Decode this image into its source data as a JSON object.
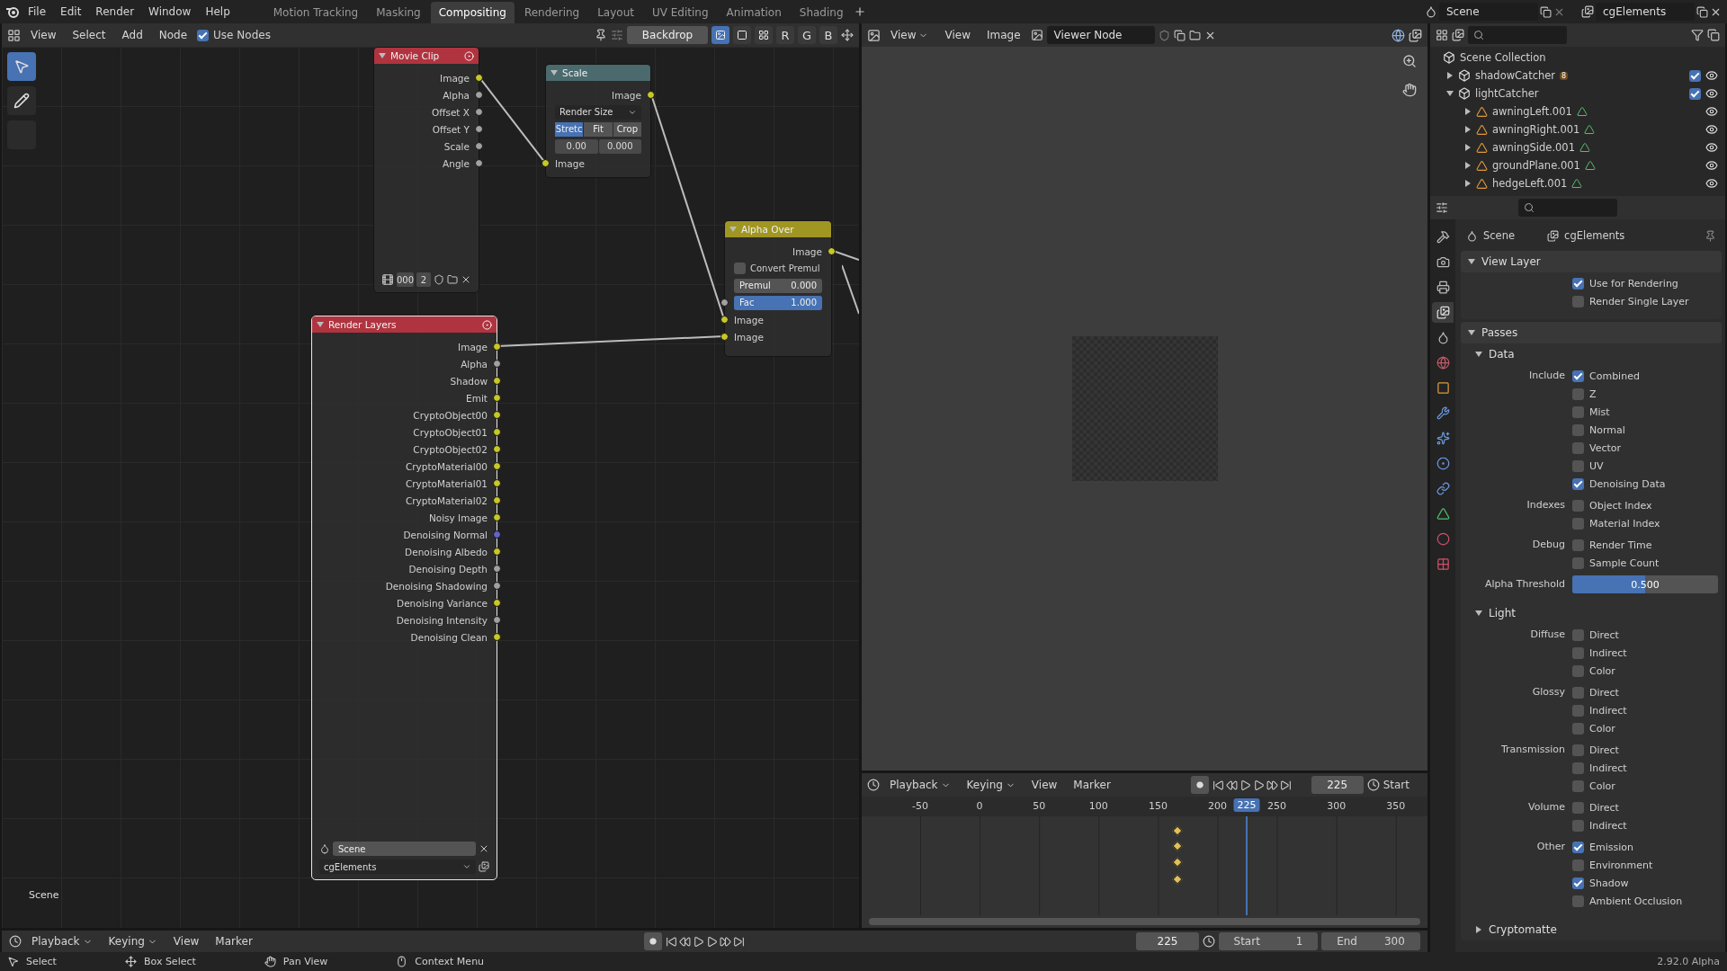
{
  "topbar": {
    "menus": [
      "File",
      "Edit",
      "Render",
      "Window",
      "Help"
    ],
    "workspaces": [
      {
        "label": "Motion Tracking",
        "selected": false
      },
      {
        "label": "Masking",
        "selected": false
      },
      {
        "label": "Compositing",
        "selected": true
      },
      {
        "label": "Rendering",
        "selected": false
      },
      {
        "label": "Layout",
        "selected": false
      },
      {
        "label": "UV Editing",
        "selected": false
      },
      {
        "label": "Animation",
        "selected": false
      },
      {
        "label": "Shading",
        "selected": false
      }
    ],
    "scene": "Scene",
    "view_layer": "cgElements"
  },
  "node_editor": {
    "menus": [
      "View",
      "Select",
      "Add",
      "Node"
    ],
    "use_nodes": {
      "label": "Use Nodes",
      "checked": true
    },
    "backdrop": "Backdrop",
    "channel_buttons": [
      {
        "kind": "color_alpha",
        "selected": true
      },
      {
        "kind": "color",
        "selected": false
      },
      {
        "kind": "alpha",
        "selected": false
      }
    ],
    "channels": [
      "R",
      "G",
      "B"
    ],
    "tools": [
      {
        "kind": "select",
        "selected": true
      },
      {
        "kind": "annotate",
        "selected": false
      },
      {
        "kind": "measure",
        "selected": false
      }
    ],
    "nodes": [
      {
        "title": "Movie Clip",
        "kind": "input",
        "selected": false,
        "rows": [
          {
            "kind": "output",
            "label": "Image",
            "color": "#c7c729"
          },
          {
            "kind": "output",
            "label": "Alpha",
            "color": "#a1a1a1"
          },
          {
            "kind": "output",
            "label": "Offset X",
            "color": "#a1a1a1"
          },
          {
            "kind": "output",
            "label": "Offset Y",
            "color": "#a1a1a1"
          },
          {
            "kind": "output",
            "label": "Scale",
            "color": "#a1a1a1"
          },
          {
            "kind": "output",
            "label": "Angle",
            "color": "#a1a1a1"
          }
        ],
        "footer": {
          "kind": "clip",
          "frame": "000",
          "users": "2"
        }
      },
      {
        "title": "Scale",
        "kind": "distort",
        "selected": false,
        "rows": [
          {
            "kind": "output",
            "label": "Image",
            "color": "#c7c729"
          },
          {
            "kind": "dropdown",
            "label": "Render Size"
          },
          {
            "kind": "segmented",
            "options": [
              {
                "label": "Stretc",
                "selected": true
              },
              {
                "label": "Fit",
                "selected": false
              },
              {
                "label": "Crop",
                "selected": false
              }
            ]
          },
          {
            "kind": "numbers",
            "values": [
              "0.00",
              "0.000"
            ]
          },
          {
            "kind": "input",
            "label": "Image",
            "color": "#c7c729"
          }
        ]
      },
      {
        "title": "Alpha Over",
        "kind": "color",
        "selected": false,
        "rows": [
          {
            "kind": "output",
            "label": "Image",
            "color": "#c7c729"
          },
          {
            "kind": "checkbox",
            "label": "Convert Premul",
            "checked": false
          },
          {
            "kind": "field",
            "label": "Premul",
            "value": "0.000"
          },
          {
            "kind": "slider",
            "label": "Fac",
            "value": "1.000",
            "level": 1,
            "color": "#a1a1a1"
          },
          {
            "kind": "input",
            "label": "Image",
            "color": "#c7c729"
          },
          {
            "kind": "input",
            "label": "Image",
            "color": "#c7c729"
          }
        ]
      },
      {
        "title": "Render Layers",
        "kind": "input",
        "selected": true,
        "rows": [
          {
            "kind": "output",
            "label": "Image",
            "color": "#c7c729"
          },
          {
            "kind": "output",
            "label": "Alpha",
            "color": "#a1a1a1"
          },
          {
            "kind": "output",
            "label": "Shadow",
            "color": "#c7c729"
          },
          {
            "kind": "output",
            "label": "Emit",
            "color": "#c7c729"
          },
          {
            "kind": "output",
            "label": "CryptoObject00",
            "color": "#c7c729"
          },
          {
            "kind": "output",
            "label": "CryptoObject01",
            "color": "#c7c729"
          },
          {
            "kind": "output",
            "label": "CryptoObject02",
            "color": "#c7c729"
          },
          {
            "kind": "output",
            "label": "CryptoMaterial00",
            "color": "#c7c729"
          },
          {
            "kind": "output",
            "label": "CryptoMaterial01",
            "color": "#c7c729"
          },
          {
            "kind": "output",
            "label": "CryptoMaterial02",
            "color": "#c7c729"
          },
          {
            "kind": "output",
            "label": "Noisy Image",
            "color": "#c7c729"
          },
          {
            "kind": "output",
            "label": "Denoising Normal",
            "color": "#6363c7"
          },
          {
            "kind": "output",
            "label": "Denoising Albedo",
            "color": "#c7c729"
          },
          {
            "kind": "output",
            "label": "Denoising Depth",
            "color": "#a1a1a1"
          },
          {
            "kind": "output",
            "label": "Denoising Shadowing",
            "color": "#a1a1a1"
          },
          {
            "kind": "output",
            "label": "Denoising Variance",
            "color": "#c7c729"
          },
          {
            "kind": "output",
            "label": "Denoising Intensity",
            "color": "#a1a1a1"
          },
          {
            "kind": "output",
            "label": "Denoising Clean",
            "color": "#c7c729"
          }
        ],
        "footer": {
          "kind": "scene",
          "scene": "Scene",
          "layer": "cgElements"
        }
      }
    ],
    "scene_label": "Scene"
  },
  "image_editor": {
    "view_menu": "View",
    "menus": [
      "View",
      "Image"
    ],
    "image": "Viewer Node"
  },
  "timeline": {
    "menus": [
      {
        "label": "Playback",
        "dropdown": true
      },
      {
        "label": "Keying",
        "dropdown": true
      },
      {
        "label": "View",
        "dropdown": false
      },
      {
        "label": "Marker",
        "dropdown": false
      }
    ],
    "frame": "225",
    "start_label": "Start",
    "ruler": [
      "-50",
      "0",
      "50",
      "100",
      "150",
      "200",
      "250",
      "300",
      "350"
    ],
    "current": "225"
  },
  "bottom_timeline": {
    "menus": [
      {
        "label": "Playback",
        "dropdown": true
      },
      {
        "label": "Keying",
        "dropdown": true
      },
      {
        "label": "View",
        "dropdown": false
      },
      {
        "label": "Marker",
        "dropdown": false
      }
    ],
    "frame": "225",
    "start_label": "Start",
    "start": "1",
    "end_label": "End",
    "end": "300"
  },
  "outliner": {
    "root": "Scene Collection",
    "items": [
      {
        "name": "shadowCatcher",
        "kind": "collection",
        "expanded": false,
        "checked": true,
        "visible": true,
        "badge": "8"
      },
      {
        "name": "lightCatcher",
        "kind": "collection",
        "expanded": true,
        "checked": true,
        "visible": true,
        "children": [
          {
            "name": "awningLeft.001",
            "kind": "mesh",
            "expanded": false,
            "visible": true
          },
          {
            "name": "awningRight.001",
            "kind": "mesh",
            "expanded": false,
            "visible": true
          },
          {
            "name": "awningSide.001",
            "kind": "mesh",
            "expanded": false,
            "visible": true
          },
          {
            "name": "groundPlane.001",
            "kind": "mesh",
            "expanded": false,
            "visible": true
          },
          {
            "name": "hedgeLeft.001",
            "kind": "mesh",
            "expanded": false,
            "visible": true
          }
        ]
      }
    ]
  },
  "properties": {
    "tabs": [
      {
        "kind": "tool",
        "selected": false
      },
      {
        "kind": "render",
        "selected": false
      },
      {
        "kind": "output",
        "selected": false
      },
      {
        "kind": "view_layer",
        "selected": true
      },
      {
        "kind": "scene",
        "selected": false
      },
      {
        "kind": "world",
        "selected": false
      },
      {
        "kind": "object",
        "selected": false
      },
      {
        "kind": "modifiers",
        "selected": false
      },
      {
        "kind": "particles",
        "selected": false
      },
      {
        "kind": "physics",
        "selected": false
      },
      {
        "kind": "constraints",
        "selected": false
      },
      {
        "kind": "data",
        "selected": false
      },
      {
        "kind": "material",
        "selected": false
      },
      {
        "kind": "texture",
        "selected": false
      }
    ],
    "scene": "Scene",
    "layer": "cgElements",
    "panels": [
      {
        "title": "View Layer",
        "expanded": true,
        "rows": [
          {
            "kind": "checks",
            "options": [
              {
                "label": "Use for Rendering",
                "checked": true
              },
              {
                "label": "Render Single Layer",
                "checked": false
              }
            ]
          }
        ]
      },
      {
        "title": "Passes",
        "expanded": true,
        "subpanels": [
          {
            "title": "Data",
            "expanded": true,
            "rows": [
              {
                "kind": "checks",
                "label": "Include",
                "options": [
                  {
                    "label": "Combined",
                    "checked": true
                  },
                  {
                    "label": "Z",
                    "checked": false
                  },
                  {
                    "label": "Mist",
                    "checked": false
                  },
                  {
                    "label": "Normal",
                    "checked": false
                  },
                  {
                    "label": "Vector",
                    "checked": false
                  },
                  {
                    "label": "UV",
                    "checked": false
                  },
                  {
                    "label": "Denoising Data",
                    "checked": true
                  }
                ]
              },
              {
                "kind": "checks",
                "label": "Indexes",
                "options": [
                  {
                    "label": "Object Index",
                    "checked": false
                  },
                  {
                    "label": "Material Index",
                    "checked": false
                  }
                ]
              },
              {
                "kind": "checks",
                "label": "Debug",
                "options": [
                  {
                    "label": "Render Time",
                    "checked": false
                  },
                  {
                    "label": "Sample Count",
                    "checked": false
                  }
                ]
              },
              {
                "kind": "slider",
                "label": "Alpha Threshold",
                "value": "0.500",
                "level": 0.5
              }
            ]
          },
          {
            "title": "Light",
            "expanded": true,
            "rows": [
              {
                "kind": "checks",
                "label": "Diffuse",
                "options": [
                  {
                    "label": "Direct",
                    "checked": false
                  },
                  {
                    "label": "Indirect",
                    "checked": false
                  },
                  {
                    "label": "Color",
                    "checked": false
                  }
                ]
              },
              {
                "kind": "checks",
                "label": "Glossy",
                "options": [
                  {
                    "label": "Direct",
                    "checked": false
                  },
                  {
                    "label": "Indirect",
                    "checked": false
                  },
                  {
                    "label": "Color",
                    "checked": false
                  }
                ]
              },
              {
                "kind": "checks",
                "label": "Transmission",
                "options": [
                  {
                    "label": "Direct",
                    "checked": false
                  },
                  {
                    "label": "Indirect",
                    "checked": false
                  },
                  {
                    "label": "Color",
                    "checked": false
                  }
                ]
              },
              {
                "kind": "checks",
                "label": "Volume",
                "options": [
                  {
                    "label": "Direct",
                    "checked": false
                  },
                  {
                    "label": "Indirect",
                    "checked": false
                  }
                ]
              },
              {
                "kind": "checks",
                "label": "Other",
                "options": [
                  {
                    "label": "Emission",
                    "checked": true
                  },
                  {
                    "label": "Environment",
                    "checked": false
                  },
                  {
                    "label": "Shadow",
                    "checked": true
                  },
                  {
                    "label": "Ambient Occlusion",
                    "checked": false
                  }
                ]
              }
            ]
          },
          {
            "title": "Cryptomatte",
            "expanded": false
          }
        ]
      }
    ]
  },
  "status_bar": {
    "items": [
      {
        "kind": "left",
        "label": "Select"
      },
      {
        "kind": "drag",
        "label": "Box Select"
      },
      {
        "kind": "middle",
        "label": "Pan View"
      },
      {
        "kind": "right",
        "label": "Context Menu"
      }
    ],
    "version": "2.92.0 Alpha"
  }
}
